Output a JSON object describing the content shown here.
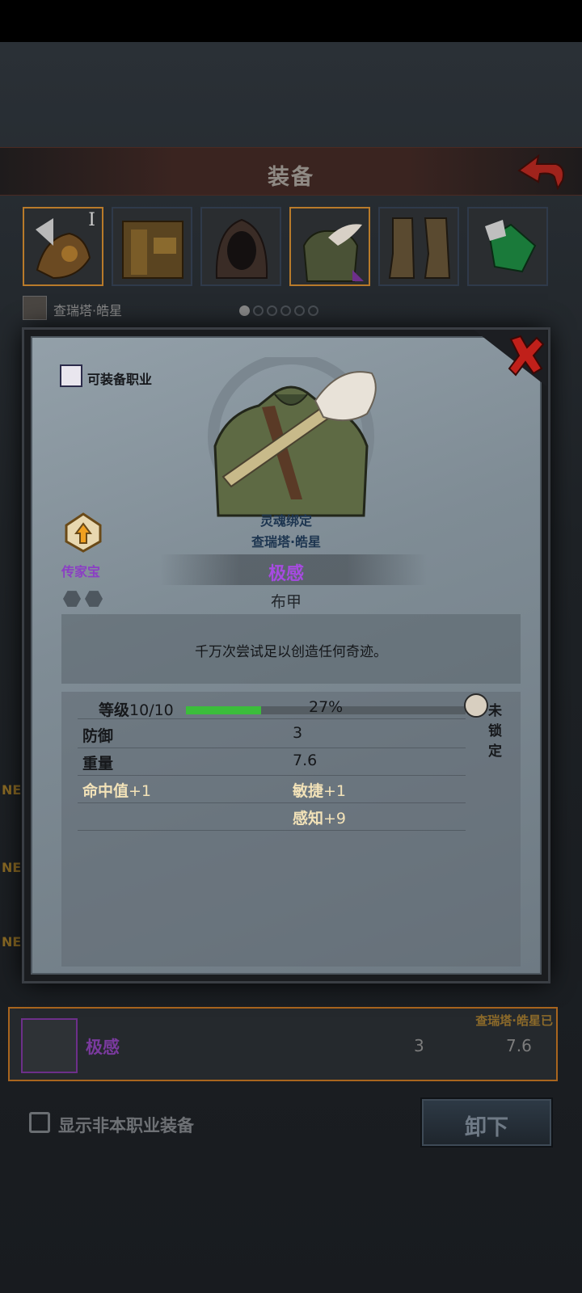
{
  "header": {
    "title": "装备"
  },
  "slots": [
    {
      "name": "trinket",
      "level_mark": "I"
    },
    {
      "name": "weapon"
    },
    {
      "name": "hood"
    },
    {
      "name": "armor"
    },
    {
      "name": "boots"
    },
    {
      "name": "accessory"
    }
  ],
  "character": {
    "name": "查瑞塔·皓星",
    "page_index": 0,
    "page_count": 6
  },
  "detail": {
    "class_requirement_label": "可装备职业",
    "soulbound_label": "灵魂绑定",
    "soulbound_owner": "查瑞塔·皓星",
    "rarity_label": "传家宝",
    "item_name": "极感",
    "item_type": "布甲",
    "description": "千万次尝试足以创造任何奇迹。",
    "level_label": "等级",
    "level_value": "10/10",
    "progress_text": "27%",
    "progress_fraction": 0.27,
    "lock_label": "未锁定",
    "stats": [
      {
        "key": "防御",
        "value": "3"
      },
      {
        "key": "重量",
        "value": "7.6"
      }
    ],
    "bonuses": [
      {
        "left": "命中值",
        "left_val": "+1",
        "right": "敏捷",
        "right_val": "+1"
      },
      {
        "left": "",
        "left_val": "",
        "right": "感知",
        "right_val": "+9"
      }
    ]
  },
  "list_item": {
    "name": "极感",
    "owner": "查瑞塔·皓星已",
    "defense": "3",
    "weight": "7.6"
  },
  "side_badges": [
    "NE",
    "NE",
    "NE"
  ],
  "footer": {
    "checkbox_label": "显示非本职业装备",
    "unequip_label": "卸下"
  },
  "colors": {
    "rarity_purple": "#a64be0",
    "xp_green": "#3bbd3b",
    "highlight_orange": "#b87a2a"
  }
}
